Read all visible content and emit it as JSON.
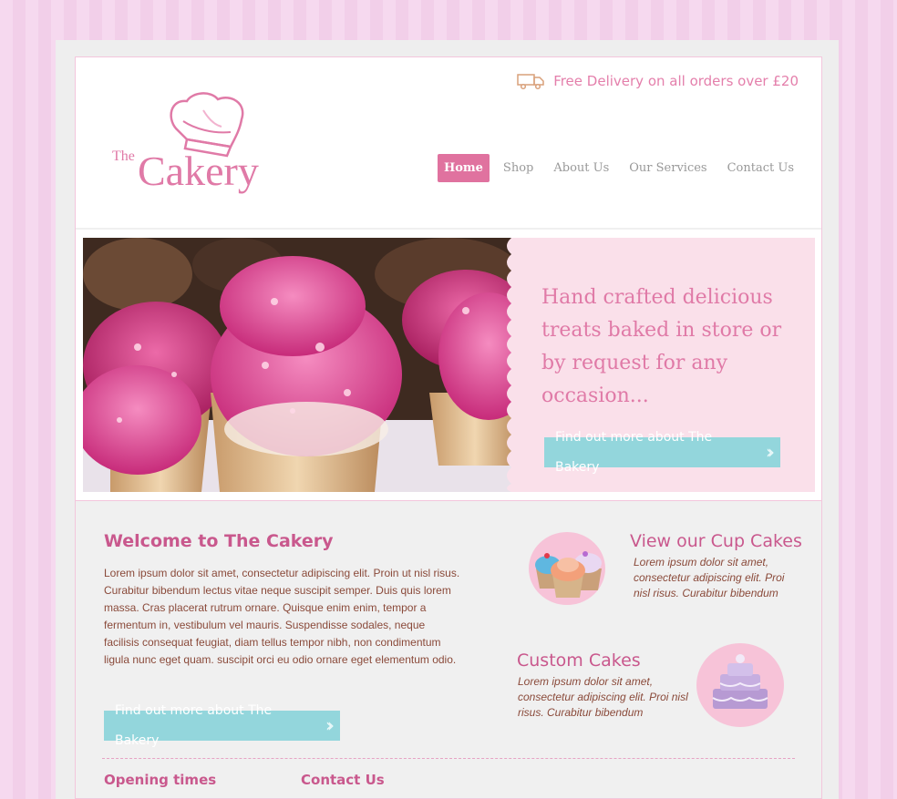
{
  "header": {
    "delivery_text": "Free Delivery on all orders over £20",
    "logo_the": "The",
    "logo_name": "Cakery"
  },
  "nav": {
    "items": [
      {
        "label": "Home",
        "active": true
      },
      {
        "label": "Shop",
        "active": false
      },
      {
        "label": "About Us",
        "active": false
      },
      {
        "label": "Our Services",
        "active": false
      },
      {
        "label": "Contact Us",
        "active": false
      }
    ]
  },
  "hero": {
    "headline": "Hand crafted delicious treats baked in store or by request for any occasion...",
    "button_label": "Find out more about The Bakery"
  },
  "welcome": {
    "title": "Welcome to The Cakery",
    "body": "Lorem ipsum dolor sit amet, consectetur adipiscing elit. Proin ut nisl risus. Curabitur bibendum lectus vitae neque suscipit semper. Duis quis lorem massa. Cras placerat rutrum ornare. Quisque enim enim, tempor a fermentum in, vestibulum vel mauris. Suspendisse sodales, neque facilisis consequat feugiat, diam tellus tempor nibh, non condimentum ligula nunc eget quam. suscipit orci eu odio ornare eget elementum odio.",
    "button_label": "Find out more about The Bakery"
  },
  "features": [
    {
      "title": "View our Cup Cakes",
      "text": "Lorem ipsum dolor sit amet, consectetur adipiscing elit. Proi nisl risus. Curabitur bibendum",
      "icon": "cupcakes-icon"
    },
    {
      "title": "Custom Cakes",
      "text": "Lorem ipsum dolor sit amet, consectetur adipiscing elit. Proi nisl risus. Curabitur bibendum",
      "icon": "wedding-cake-icon"
    }
  ],
  "footer": {
    "opening_times": "Opening times",
    "contact_us": "Contact Us"
  },
  "colors": {
    "brand_pink": "#e07aa7",
    "accent_teal": "#93d6dc",
    "panel_pink": "#fae0ea"
  }
}
